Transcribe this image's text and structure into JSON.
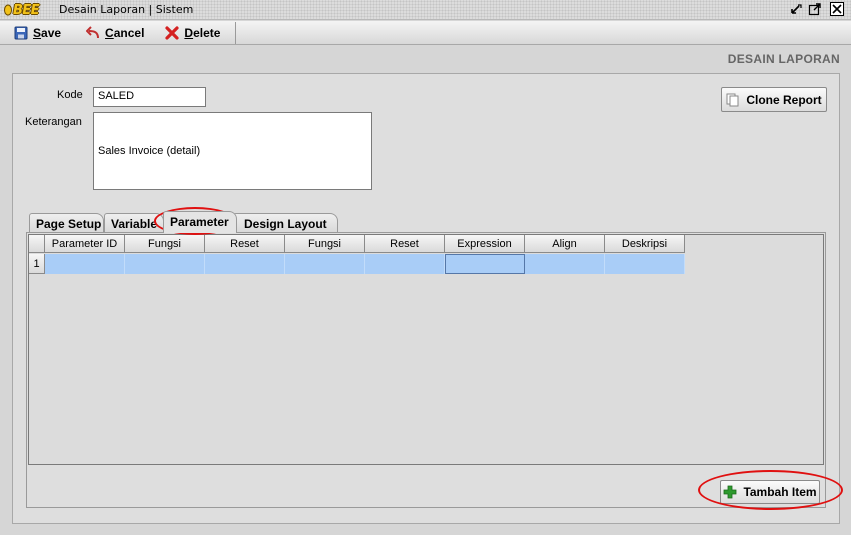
{
  "window": {
    "logo_text": "BEE",
    "title": "Desain Laporan | Sistem"
  },
  "toolbar": {
    "save_label": "Save",
    "cancel_label": "Cancel",
    "delete_label": "Delete"
  },
  "header": {
    "title": "DESAIN LAPORAN"
  },
  "form": {
    "kode_label": "Kode",
    "kode_value": "SALED",
    "keterangan_label": "Keterangan",
    "keterangan_value": "Sales Invoice (detail)",
    "clone_button": "Clone Report"
  },
  "tabs": [
    {
      "label": "Page Setup"
    },
    {
      "label": "Variable"
    },
    {
      "label": "Parameter",
      "active": true
    },
    {
      "label": "Design Layout"
    }
  ],
  "grid": {
    "columns": [
      "Parameter ID",
      "Fungsi",
      "Reset",
      "Fungsi",
      "Reset",
      "Expression",
      "Align",
      "Deskripsi"
    ],
    "rows": [
      {
        "num": "1",
        "cells": [
          "",
          "",
          "",
          "",
          "",
          "",
          "",
          ""
        ]
      }
    ]
  },
  "footer": {
    "add_button": "Tambah Item"
  },
  "colors": {
    "highlight": "#e01010",
    "row_selected": "#a9cdf7",
    "add_icon": "#2e9a2e",
    "delete_icon": "#d42020"
  },
  "icons": {
    "save": "floppy-disk-icon",
    "cancel": "undo-arrow-icon",
    "delete": "red-x-icon",
    "clone": "copy-document-icon",
    "add": "green-plus-icon"
  }
}
